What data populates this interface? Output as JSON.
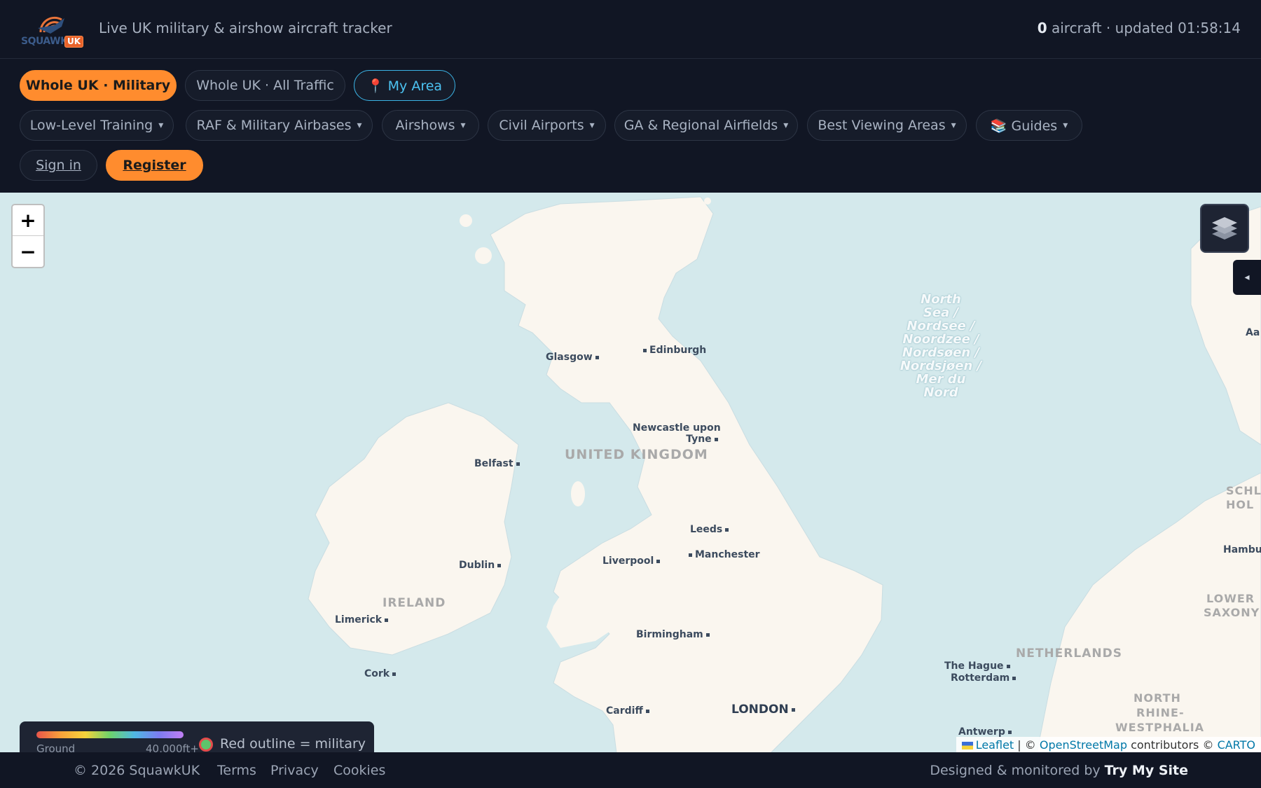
{
  "header": {
    "logo_text": "SQUAWK",
    "logo_badge": "UK",
    "tagline": "Live UK military & airshow aircraft tracker",
    "aircraft_count": "0",
    "status_suffix": "aircraft · updated 01:58:14"
  },
  "modes": [
    {
      "label": "Whole UK · Military",
      "active": true
    },
    {
      "label": "Whole UK · All Traffic",
      "active": false
    },
    {
      "label": "📍 My Area",
      "active": false
    }
  ],
  "menus": [
    {
      "label": "Low-Level Training"
    },
    {
      "label": "RAF & Military Airbases"
    },
    {
      "label": "Airshows"
    },
    {
      "label": "Civil Airports"
    },
    {
      "label": "GA & Regional Airfields"
    },
    {
      "label": "Best Viewing Areas"
    },
    {
      "label": "📚 Guides"
    }
  ],
  "caret": "▾",
  "auth": {
    "signin": "Sign in",
    "register": "Register"
  },
  "map": {
    "zoom_in": "+",
    "zoom_out": "−",
    "side_toggle": "◂",
    "sea_label": [
      "North",
      "Sea /",
      "Nordsee /",
      "Noordzee /",
      "Nordsøen /",
      "Nordsjøen /",
      "Mer du",
      "Nord"
    ],
    "countries": {
      "uk": "UNITED KINGDOM",
      "ireland": "IRELAND",
      "netherlands": "NETHERLANDS",
      "schleswig": "SCHL- HOL",
      "lower_saxony_1": "LOWER",
      "lower_saxony_2": "SAXONY",
      "nrw_1": "NORTH",
      "nrw_2": "RHINE-",
      "nrw_3": "WESTPHALIA"
    },
    "cities": {
      "glasgow": "Glasgow",
      "edinburgh": "Edinburgh",
      "newcastle_1": "Newcastle upon",
      "newcastle_2": "Tyne",
      "belfast": "Belfast",
      "leeds": "Leeds",
      "liverpool": "Liverpool",
      "manchester": "Manchester",
      "dublin": "Dublin",
      "limerick": "Limerick",
      "birmingham": "Birmingham",
      "cork": "Cork",
      "cardiff": "Cardiff",
      "london": "LONDON",
      "the_hague": "The Hague",
      "rotterdam": "Rotterdam",
      "antwerp": "Antwerp",
      "hamburg": "Hambu",
      "aa": "Aa"
    },
    "attribution": {
      "leaflet": "Leaflet",
      "sep": "| ©",
      "osm": "OpenStreetMap",
      "mid": "contributors ©",
      "carto": "CARTO"
    }
  },
  "legend": {
    "ground": "Ground",
    "top": "40,000ft+",
    "military": "Red outline = military"
  },
  "footer": {
    "copyright": "© 2026 SquawkUK",
    "terms": "Terms",
    "privacy": "Privacy",
    "cookies": "Cookies",
    "designed": "Designed & monitored by",
    "brand": "Try My Site"
  }
}
